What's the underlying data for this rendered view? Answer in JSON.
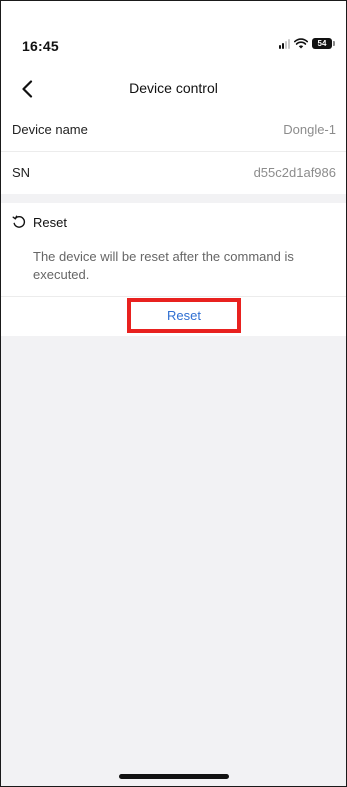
{
  "status_bar": {
    "time": "16:45",
    "battery": "54"
  },
  "nav": {
    "title": "Device control",
    "back_icon": "chevron-left-icon"
  },
  "device_info": {
    "name_label": "Device name",
    "name_value": "Dongle-1",
    "sn_label": "SN",
    "sn_value": "d55c2d1af986"
  },
  "reset": {
    "icon": "reset-icon",
    "title": "Reset",
    "description": "The device will be reset after the command is executed.",
    "button_label": "Reset"
  },
  "colors": {
    "accent_link": "#2f6fd2",
    "highlight": "#e8211f",
    "background": "#f2f2f4"
  }
}
